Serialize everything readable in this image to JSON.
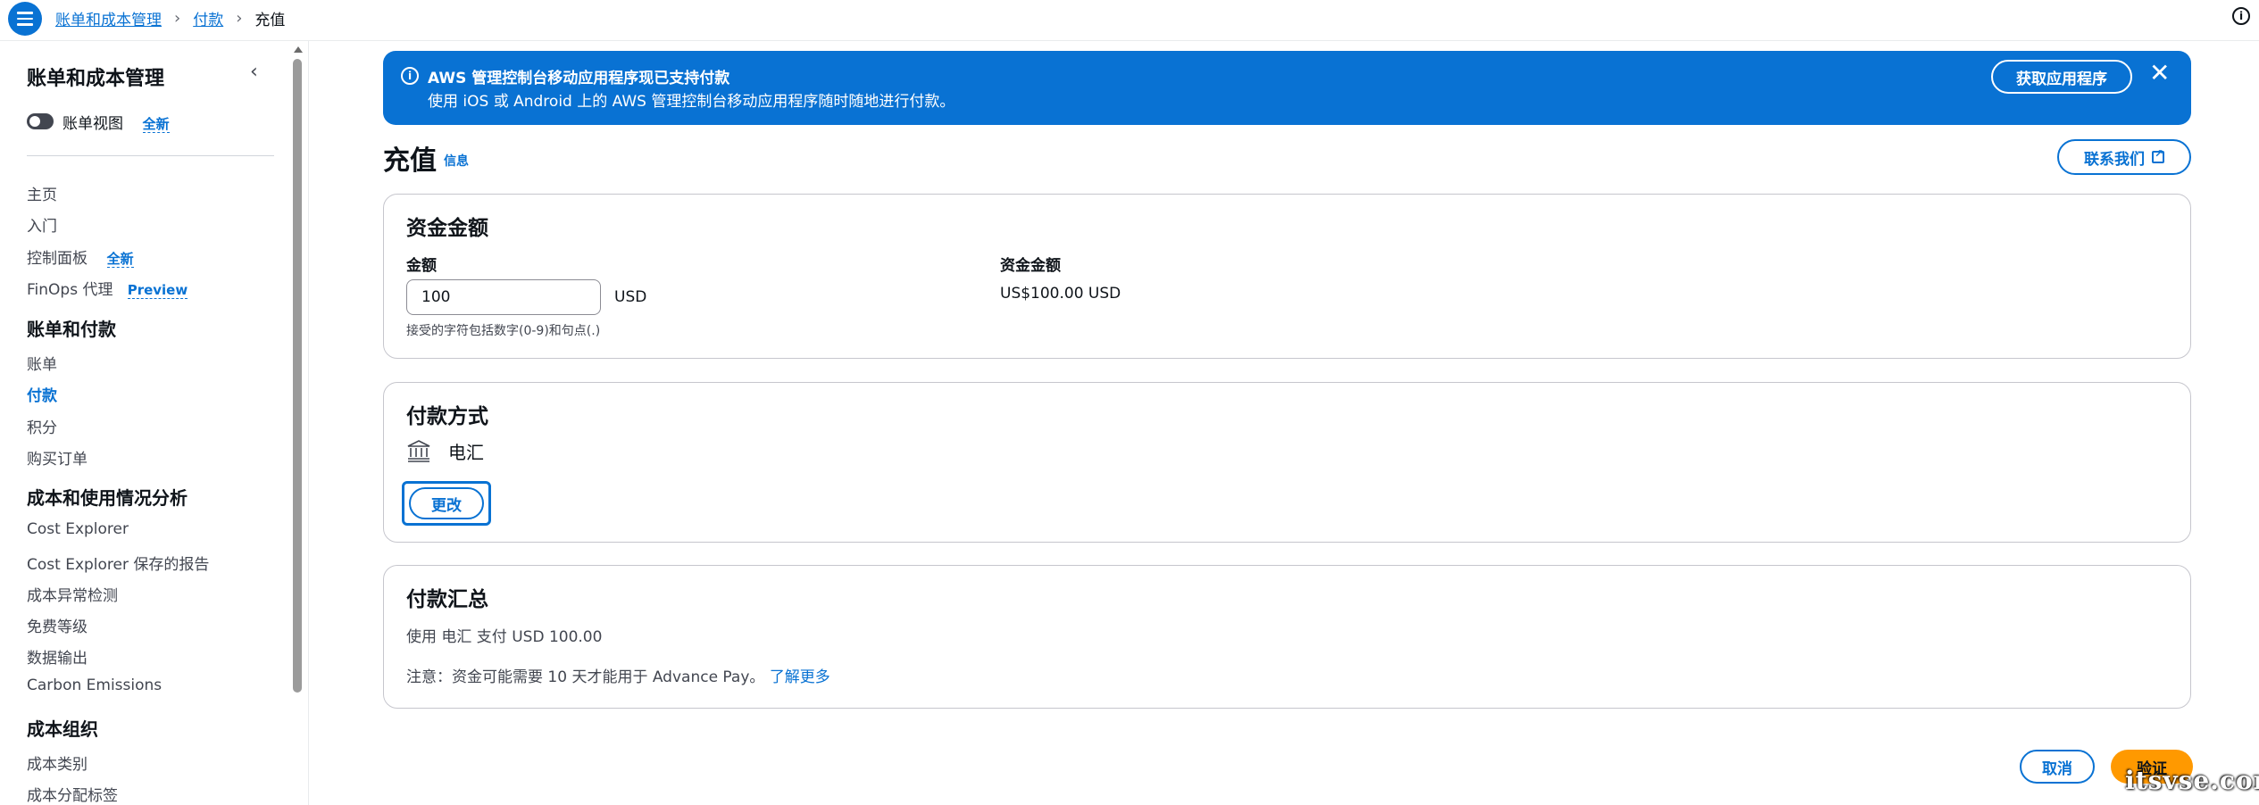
{
  "breadcrumb": {
    "items": [
      "账单和成本管理",
      "付款"
    ],
    "current": "充值"
  },
  "sidebar": {
    "title": "账单和成本管理",
    "toggle_label": "账单视图",
    "new_badge": "全新",
    "preview_badge": "Preview",
    "items_top": [
      "主页",
      "入门",
      "控制面板",
      "FinOps 代理"
    ],
    "section_billing": "账单和付款",
    "items_billing": [
      "账单",
      "付款",
      "积分",
      "购买订单"
    ],
    "section_cost": "成本和使用情况分析",
    "items_cost": [
      "Cost Explorer",
      "Cost Explorer 保存的报告",
      "成本异常检测",
      "免费等级",
      "数据输出",
      "Carbon Emissions"
    ],
    "section_org": "成本组织",
    "items_org": [
      "成本类别",
      "成本分配标签"
    ],
    "active_item": "付款"
  },
  "banner": {
    "title": "AWS 管理控制台移动应用程序现已支持付款",
    "text": "使用 iOS 或 Android 上的 AWS 管理控制台移动应用程序随时随地进行付款。",
    "button": "获取应用程序",
    "close": "✕"
  },
  "page": {
    "title": "充值",
    "info": "信息",
    "contact_button": "联系我们"
  },
  "funding": {
    "title": "资金金额",
    "amount_label": "金额",
    "amount_value": "100",
    "unit": "USD",
    "hint": "接受的字符包括数字(0-9)和句点(.)",
    "fund_label": "资金金额",
    "fund_value": "US$100.00 USD"
  },
  "payment_method": {
    "title": "付款方式",
    "icon": "bank-icon",
    "method": "电汇",
    "change_button": "更改"
  },
  "summary": {
    "title": "付款汇总",
    "line": "使用 电汇 支付 USD 100.00",
    "note": "注意：资金可能需要 10 天才能用于 Advance Pay。",
    "learn_more": "了解更多"
  },
  "footer": {
    "cancel": "取消",
    "verify": "验证"
  },
  "watermark": "itsvse.com",
  "colors": {
    "primary": "#0972d3",
    "accent": "#ff9900",
    "text": "#0f141a"
  }
}
